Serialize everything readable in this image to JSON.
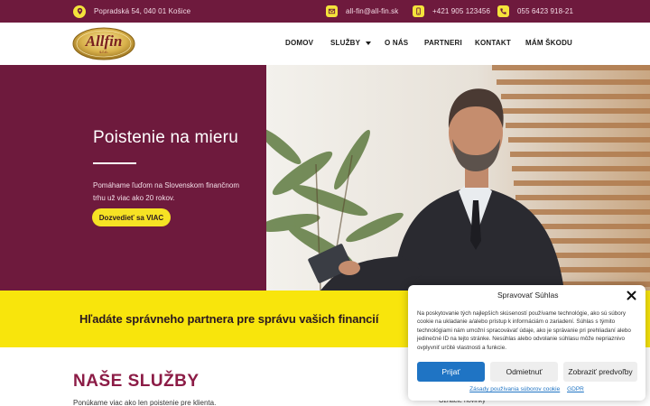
{
  "topbar": {
    "address": "Popradská 54, 040 01 Košice",
    "email": "all-fin@all-fin.sk",
    "phone_mobile": "+421 905 123456",
    "phone_office": "055 6423 918-21",
    "icons": [
      "location-pin-icon",
      "envelope-icon",
      "mobile-phone-icon",
      "phone-icon"
    ]
  },
  "nav": {
    "logo_text": "Allfin",
    "logo_sub": "s.r.o.",
    "items": [
      {
        "label": "DOMOV"
      },
      {
        "label": "SLUŽBY",
        "has_dropdown": true
      },
      {
        "label": "O NÁS"
      },
      {
        "label": "PARTNERI"
      },
      {
        "label": "KONTAKT"
      },
      {
        "label": "MÁM ŠKODU"
      }
    ]
  },
  "hero": {
    "title": "Poistenie na mieru",
    "description": "Pomáhame ľuďom na Slovenskom finančnom trhu už viac ako 20 rokov.",
    "button": "Dozvedieť sa VIAC"
  },
  "band": {
    "text": "Hľadáte správneho partnera pre správu vašich financií"
  },
  "services": {
    "title": "NAŠE SLUŽBY",
    "subtitle": "Ponúkame viac ako len poistenie pre klienta.",
    "peek": "Označte novinky"
  },
  "cookie": {
    "title": "Spravovať Súhlas",
    "body": "Na poskytovanie tých najlepších skúseností používame technológie, ako sú súbory cookie na ukladanie a/alebo prístup k informáciám o zariadení. Súhlas s týmito technológiami nám umožní spracovávať údaje, ako je správanie pri prehliadaní alebo jedinečné ID na tejto stránke. Nesúhlas alebo odvolanie súhlasu môže nepriaznivo ovplyvniť určité vlastnosti a funkcie.",
    "accept": "Prijať",
    "deny": "Odmietnuť",
    "preferences": "Zobraziť predvoľby",
    "link_policy": "Zásady používania súborov cookie",
    "link_gdpr": "GDPR"
  },
  "colors": {
    "brand_maroon": "#6e1a3d",
    "accent_yellow": "#f8e50c",
    "button_blue": "#1f74c4",
    "title_maroon": "#8c1c46"
  }
}
